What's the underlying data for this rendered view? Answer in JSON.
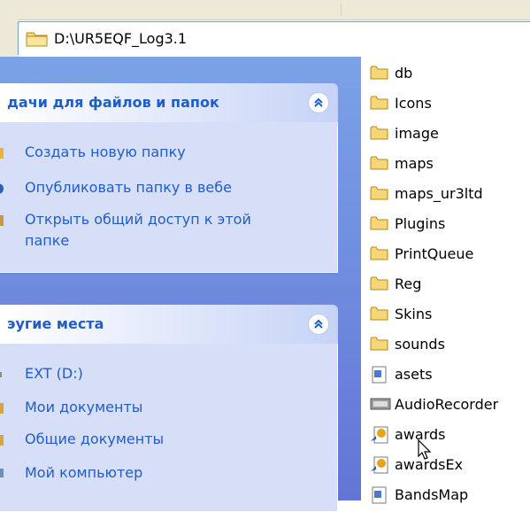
{
  "address": {
    "path": "D:\\UR5EQF_Log3.1"
  },
  "tasks_panel": {
    "title": "дачи для файлов и папок",
    "items": [
      {
        "label": "Создать новую папку",
        "icon": "new-folder-icon"
      },
      {
        "label": "Опубликовать папку в вебе",
        "icon": "publish-web-icon"
      },
      {
        "label_line1": "Открыть общий доступ к этой",
        "label_line2": "папке",
        "icon": "share-folder-icon"
      }
    ]
  },
  "places_panel": {
    "title": "эугие места",
    "items": [
      {
        "label": "EXT (D:)",
        "icon": "drive-icon"
      },
      {
        "label": "Мои документы",
        "icon": "my-documents-icon"
      },
      {
        "label": "Общие документы",
        "icon": "shared-documents-icon"
      },
      {
        "label": "Мой компьютер",
        "icon": "my-computer-icon"
      }
    ]
  },
  "files": [
    {
      "name": "db",
      "type": "folder"
    },
    {
      "name": "Icons",
      "type": "folder"
    },
    {
      "name": "image",
      "type": "folder"
    },
    {
      "name": "maps",
      "type": "folder"
    },
    {
      "name": "maps_ur3ltd",
      "type": "folder"
    },
    {
      "name": "Plugins",
      "type": "folder"
    },
    {
      "name": "PrintQueue",
      "type": "folder"
    },
    {
      "name": "Reg",
      "type": "folder"
    },
    {
      "name": "Skins",
      "type": "folder"
    },
    {
      "name": "sounds",
      "type": "folder"
    },
    {
      "name": "asets",
      "type": "file"
    },
    {
      "name": "AudioRecorder",
      "type": "exe"
    },
    {
      "name": "awards",
      "type": "shortcut"
    },
    {
      "name": "awardsEx",
      "type": "shortcut"
    },
    {
      "name": "BandsMap",
      "type": "file"
    }
  ],
  "colors": {
    "pane_gradient_top": "#7ba2e7",
    "pane_gradient_bottom": "#6375d6",
    "panel_body": "#d6dff7",
    "link_blue": "#215dc6",
    "folder_yellow": "#f5d77a"
  }
}
